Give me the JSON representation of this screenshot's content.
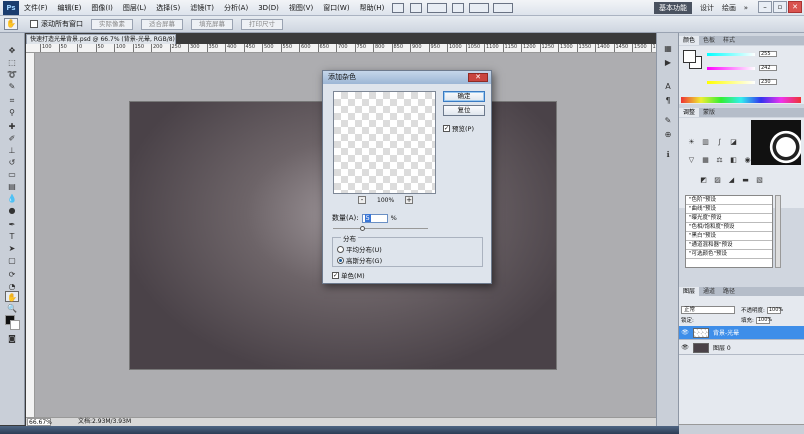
{
  "menubar": {
    "logo": "Ps",
    "items": [
      "文件(F)",
      "编辑(E)",
      "图像(I)",
      "图层(L)",
      "选择(S)",
      "滤镜(T)",
      "分析(A)",
      "3D(D)",
      "视图(V)",
      "窗口(W)",
      "帮助(H)"
    ],
    "workspace": "基本功能",
    "design": "设计",
    "painting": "绘画",
    "more": "»"
  },
  "options": {
    "scroll_all_label": "滚动所有窗口",
    "buttons": [
      "实际像素",
      "适合屏幕",
      "填充屏幕",
      "打印尺寸"
    ]
  },
  "document": {
    "tab_title": "快速打造光晕背景.psd @ 66.7% (背景-光晕, RGB/8) *",
    "ruler_ticks": [
      "100",
      "50",
      "0",
      "50",
      "100",
      "150",
      "200",
      "250",
      "300",
      "350",
      "400",
      "450",
      "500",
      "550",
      "600",
      "650",
      "700",
      "750",
      "800",
      "850",
      "900",
      "950",
      "1000",
      "1050",
      "1100",
      "1150",
      "1200",
      "1250",
      "1300",
      "1350",
      "1400",
      "1450",
      "1500",
      "1550"
    ]
  },
  "status": {
    "zoom": "66.67%",
    "docsize": "文档:2.93M/3.93M"
  },
  "dialog": {
    "title": "添加杂色",
    "ok": "确定",
    "reset": "复位",
    "preview_label": "预览(P)",
    "zoom_pct": "100%",
    "amount_label": "数量(A):",
    "amount_value": "5",
    "pct": "%",
    "dist_legend": "分布",
    "uniform_label": "平均分布(U)",
    "gaussian_label": "高斯分布(G)",
    "mono_label": "单色(M)"
  },
  "panels": {
    "color_tabs": [
      "颜色",
      "色板",
      "样式"
    ],
    "color_values": [
      "255",
      "242",
      "230"
    ],
    "adjust_tabs": [
      "调整",
      "蒙版"
    ],
    "presets": [
      "\"色阶\"预设",
      "\"曲线\"预设",
      "\"曝光度\"预设",
      "\"色相/饱和度\"预设",
      "\"黑白\"预设",
      "\"通道混和器\"预设",
      "\"可选颜色\"预设"
    ],
    "layer_tabs": [
      "图层",
      "通道",
      "路径"
    ],
    "blend_mode": "正常",
    "opacity_label": "不透明度:",
    "opacity_value": "100%",
    "lock_label": "锁定:",
    "fill_label": "填充:",
    "fill_value": "100%",
    "layers": [
      {
        "name": "背景-光晕",
        "selected": true
      },
      {
        "name": "图层 0",
        "selected": false
      }
    ]
  },
  "colors": {
    "accent": "#3e8ee9",
    "canvas_bg": "#adadb0",
    "image_center": "#9f979b",
    "image_edge": "#4a4248"
  }
}
